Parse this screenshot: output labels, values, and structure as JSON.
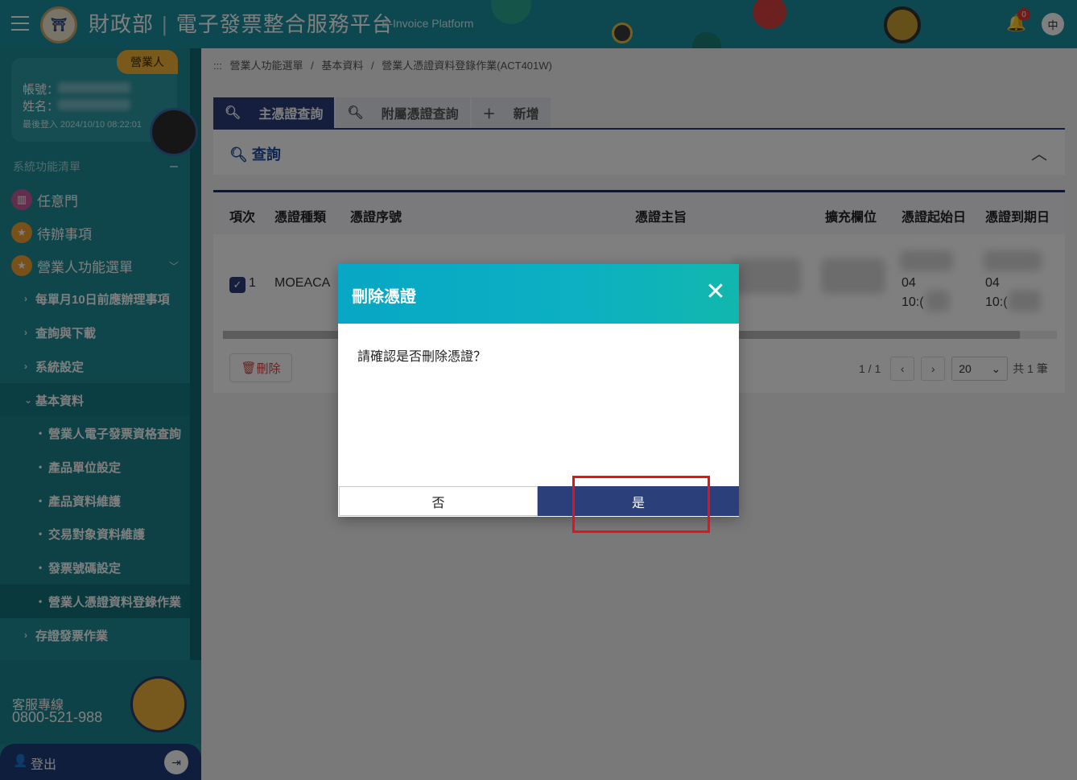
{
  "header": {
    "org": "財政部",
    "platform": "電子發票整合服務平台",
    "platform_en": "E-Invoice Platform",
    "notification_count": "0",
    "lang": "中"
  },
  "sidebar": {
    "role": "營業人",
    "account_label": "帳號：",
    "name_label": "姓名：",
    "last_login": "最後登入 2024/10/10 08:22:01",
    "menu_header": "系統功能清單",
    "top_items": [
      {
        "label": "任意門",
        "icon": "map-icon"
      },
      {
        "label": "待辦事項",
        "icon": "star-icon"
      },
      {
        "label": "營業人功能選單",
        "icon": "star-icon"
      }
    ],
    "sub_items": [
      {
        "label": "每單月10日前應辦理事項"
      },
      {
        "label": "查詢與下載"
      },
      {
        "label": "系統設定"
      },
      {
        "label": "基本資料"
      }
    ],
    "leaf_items": [
      {
        "label": "營業人電子發票資格查詢"
      },
      {
        "label": "產品單位設定"
      },
      {
        "label": "產品資料維護"
      },
      {
        "label": "交易對象資料維護"
      },
      {
        "label": "發票號碼設定"
      },
      {
        "label": "營業人憑證資料登錄作業"
      }
    ],
    "last_item": {
      "label": "存證發票作業"
    },
    "hotline_label": "客服專線",
    "hotline_number": "0800-521-988",
    "logout_label": "登出"
  },
  "breadcrumb": [
    ":::",
    "營業人功能選單",
    "/",
    "基本資料",
    "/",
    "營業人憑證資料登錄作業(ACT401W)"
  ],
  "tabs": [
    {
      "label": "主憑證查詢",
      "icon": "search-icon",
      "active": true
    },
    {
      "label": "附屬憑證查詢",
      "icon": "search-icon",
      "active": false
    },
    {
      "label": "新增",
      "icon": "plus-icon",
      "active": false
    }
  ],
  "query": {
    "title": "查詢"
  },
  "table": {
    "headers": [
      "項次",
      "憑證種類",
      "憑證序號",
      "憑證主旨",
      "擴充欄位",
      "憑證起始日",
      "憑證到期日"
    ],
    "rows": [
      {
        "index": "1",
        "type": "MOEACA",
        "start_date": "04",
        "start_time": "10:(",
        "end_date": "04",
        "end_time": "10:("
      }
    ],
    "delete_label": "刪除",
    "page_info": "1 / 1",
    "page_size": "20",
    "total": "共 1 筆"
  },
  "modal": {
    "title": "刪除憑證",
    "message": "請確認是否刪除憑證？",
    "no_label": "否",
    "yes_label": "是"
  },
  "colors": {
    "header_bg": "#1a8fa0",
    "sidebar_bg": "#1e8d97",
    "primary": "#2b3f7a",
    "modal_header_start": "#07a7c5",
    "modal_header_end": "#11b7ad",
    "highlight": "#e8101a"
  }
}
